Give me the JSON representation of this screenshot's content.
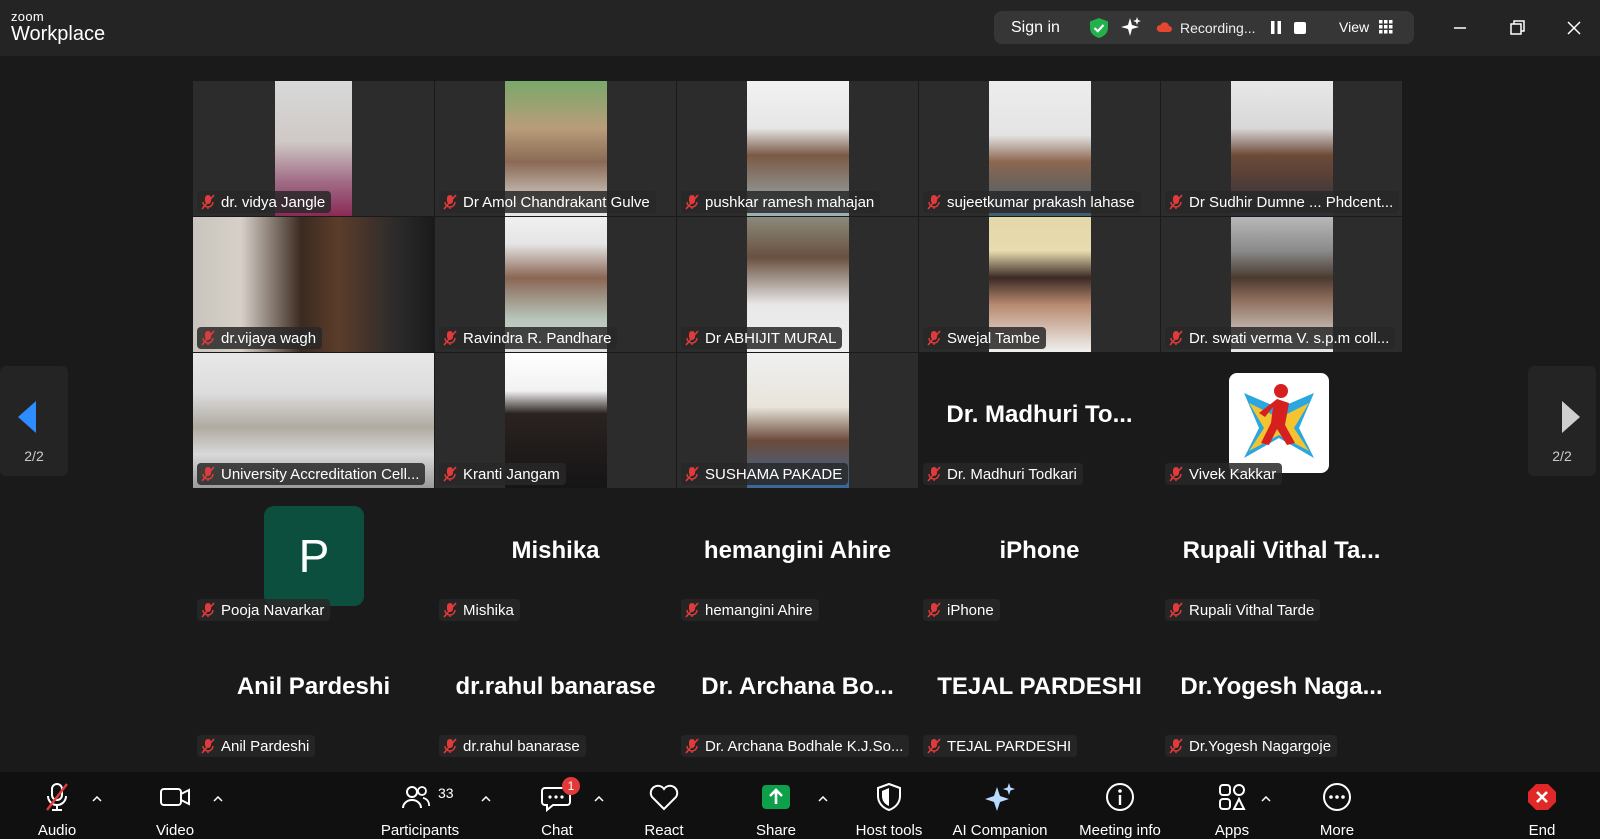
{
  "app": {
    "logo_small": "zoom",
    "logo_big": "Workplace"
  },
  "header": {
    "signin": "Sign in",
    "recording": "Recording...",
    "view": "View"
  },
  "pager": {
    "left": "2/2",
    "right": "2/2"
  },
  "tiles": [
    {
      "tag": "dr. vidya Jangle"
    },
    {
      "tag": "Dr Amol Chandrakant Gulve"
    },
    {
      "tag": "pushkar ramesh mahajan"
    },
    {
      "tag": "sujeetkumar prakash lahase"
    },
    {
      "tag": "Dr Sudhir Dumne ... Phdcent..."
    },
    {
      "tag": "dr.vijaya wagh"
    },
    {
      "tag": "Ravindra R. Pandhare"
    },
    {
      "tag": "Dr ABHIJIT MURAL"
    },
    {
      "tag": "Swejal Tambe"
    },
    {
      "tag": "Dr. swati verma V. s.p.m coll..."
    },
    {
      "tag": "University Accreditation Cell..."
    },
    {
      "tag": "Kranti Jangam"
    },
    {
      "tag": "SUSHAMA PAKADE"
    },
    {
      "tag": "Dr. Madhuri Todkari",
      "big": "Dr. Madhuri To..."
    },
    {
      "tag": "Vivek Kakkar"
    },
    {
      "tag": "Pooja Navarkar",
      "avatar": "P"
    },
    {
      "tag": "Mishika",
      "big": "Mishika"
    },
    {
      "tag": "hemangini Ahire",
      "big": "hemangini Ahire"
    },
    {
      "tag": "iPhone",
      "big": "iPhone"
    },
    {
      "tag": "Rupali Vithal Tarde",
      "big": "Rupali Vithal Ta..."
    },
    {
      "tag": "Anil Pardeshi",
      "big": "Anil Pardeshi"
    },
    {
      "tag": "dr.rahul banarase",
      "big": "dr.rahul banarase"
    },
    {
      "tag": "Dr. Archana Bodhale K.J.So...",
      "big": "Dr. Archana Bo..."
    },
    {
      "tag": "TEJAL PARDESHI",
      "big": "TEJAL PARDESHI"
    },
    {
      "tag": "Dr.Yogesh Nagargoje",
      "big": "Dr.Yogesh Naga..."
    }
  ],
  "toolbar": {
    "audio": "Audio",
    "video": "Video",
    "participants": "Participants",
    "participants_count": "33",
    "chat": "Chat",
    "chat_badge": "1",
    "react": "React",
    "share": "Share",
    "host_tools": "Host tools",
    "ai_companion": "AI Companion",
    "meeting_info": "Meeting info",
    "apps": "Apps",
    "more": "More",
    "end": "End"
  },
  "colors": {
    "accent_green": "#0e9f4a",
    "share_green": "#0e9f4a",
    "end_red": "#e02828",
    "muted_red": "#e23a3a",
    "pager_blue": "#2d8cff"
  }
}
